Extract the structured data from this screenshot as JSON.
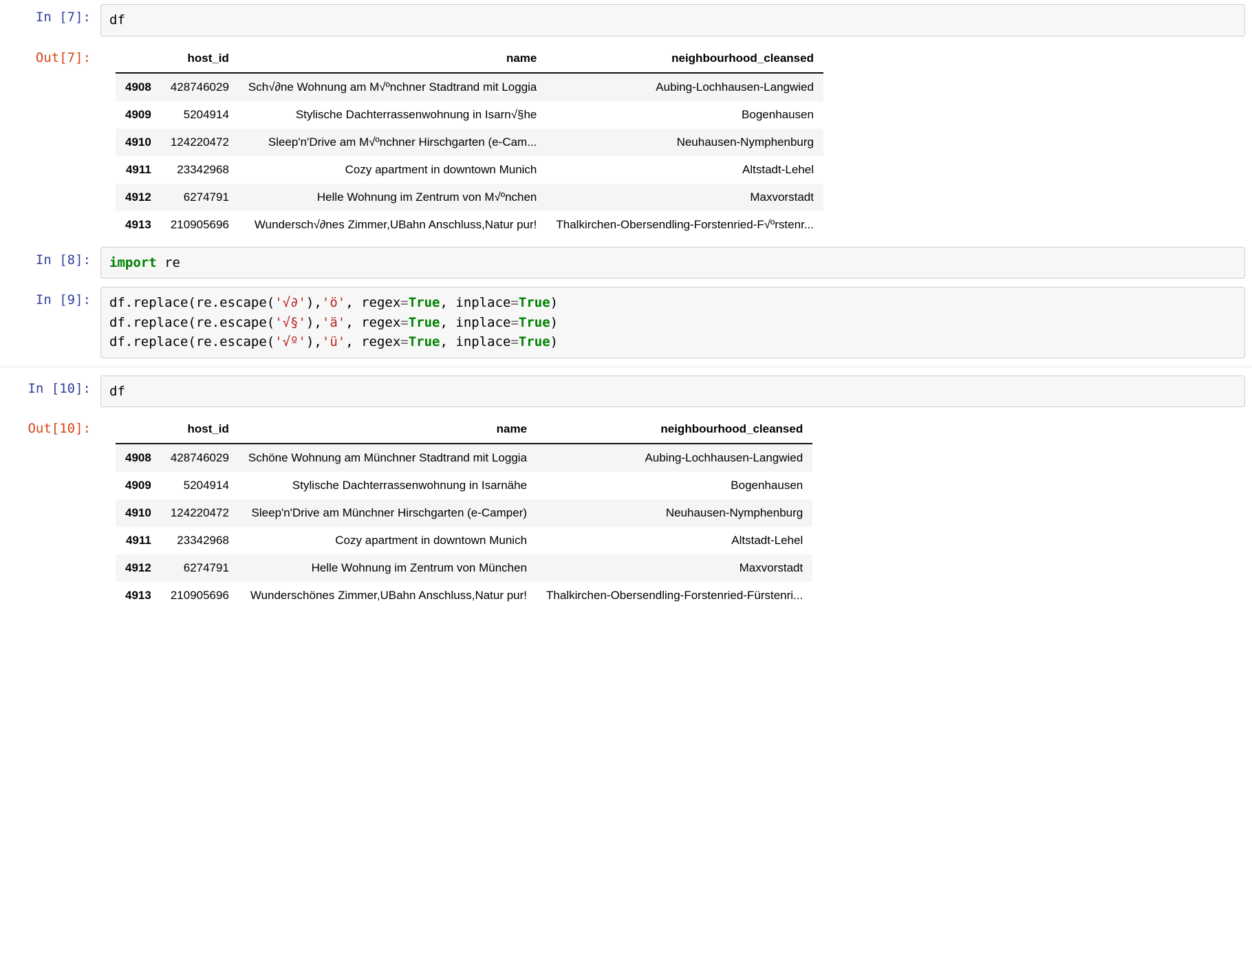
{
  "cells": [
    {
      "prompt_in": "In [7]:",
      "code_plain": "df",
      "prompt_out": "Out[7]:",
      "table": {
        "columns": [
          "",
          "host_id",
          "name",
          "neighbourhood_cleansed"
        ],
        "rows": [
          {
            "idx": "4908",
            "host_id": "428746029",
            "name": "Sch√∂ne Wohnung am M√ºnchner Stadtrand mit Loggia",
            "neighbourhood": "Aubing-Lochhausen-Langwied"
          },
          {
            "idx": "4909",
            "host_id": "5204914",
            "name": "Stylische Dachterrassenwohnung in Isarn√§he",
            "neighbourhood": "Bogenhausen"
          },
          {
            "idx": "4910",
            "host_id": "124220472",
            "name": "Sleep'n'Drive am M√ºnchner Hirschgarten (e-Cam...",
            "neighbourhood": "Neuhausen-Nymphenburg"
          },
          {
            "idx": "4911",
            "host_id": "23342968",
            "name": "Cozy apartment in downtown Munich",
            "neighbourhood": "Altstadt-Lehel"
          },
          {
            "idx": "4912",
            "host_id": "6274791",
            "name": "Helle Wohnung im Zentrum von M√ºnchen",
            "neighbourhood": "Maxvorstadt"
          },
          {
            "idx": "4913",
            "host_id": "210905696",
            "name": "Wundersch√∂nes Zimmer,UBahn Anschluss,Natur pur!",
            "neighbourhood": "Thalkirchen-Obersendling-Forstenried-F√ºrstenr..."
          }
        ]
      }
    },
    {
      "prompt_in": "In [8]:",
      "code_tokens": [
        [
          {
            "t": "import ",
            "c": "kw"
          },
          {
            "t": "re",
            "c": ""
          }
        ]
      ]
    },
    {
      "prompt_in": "In [9]:",
      "code_tokens": [
        [
          {
            "t": "df.replace(re.escape(",
            "c": ""
          },
          {
            "t": "'√∂'",
            "c": "str"
          },
          {
            "t": "),",
            "c": ""
          },
          {
            "t": "'ö'",
            "c": "str"
          },
          {
            "t": ", regex",
            "c": ""
          },
          {
            "t": "=",
            "c": "op"
          },
          {
            "t": "True",
            "c": "bool"
          },
          {
            "t": ", inplace",
            "c": ""
          },
          {
            "t": "=",
            "c": "op"
          },
          {
            "t": "True",
            "c": "bool"
          },
          {
            "t": ")",
            "c": ""
          }
        ],
        [
          {
            "t": "df.replace(re.escape(",
            "c": ""
          },
          {
            "t": "'√§'",
            "c": "str"
          },
          {
            "t": "),",
            "c": ""
          },
          {
            "t": "'ä'",
            "c": "str"
          },
          {
            "t": ", regex",
            "c": ""
          },
          {
            "t": "=",
            "c": "op"
          },
          {
            "t": "True",
            "c": "bool"
          },
          {
            "t": ", inplace",
            "c": ""
          },
          {
            "t": "=",
            "c": "op"
          },
          {
            "t": "True",
            "c": "bool"
          },
          {
            "t": ")",
            "c": ""
          }
        ],
        [
          {
            "t": "df.replace(re.escape(",
            "c": ""
          },
          {
            "t": "'√º'",
            "c": "str"
          },
          {
            "t": "),",
            "c": ""
          },
          {
            "t": "'ü'",
            "c": "str"
          },
          {
            "t": ", regex",
            "c": ""
          },
          {
            "t": "=",
            "c": "op"
          },
          {
            "t": "True",
            "c": "bool"
          },
          {
            "t": ", inplace",
            "c": ""
          },
          {
            "t": "=",
            "c": "op"
          },
          {
            "t": "True",
            "c": "bool"
          },
          {
            "t": ")",
            "c": ""
          }
        ]
      ]
    },
    {
      "prompt_in": "In [10]:",
      "code_plain": "df",
      "prompt_out": "Out[10]:",
      "table": {
        "columns": [
          "",
          "host_id",
          "name",
          "neighbourhood_cleansed"
        ],
        "rows": [
          {
            "idx": "4908",
            "host_id": "428746029",
            "name": "Schöne Wohnung am Münchner Stadtrand mit Loggia",
            "neighbourhood": "Aubing-Lochhausen-Langwied"
          },
          {
            "idx": "4909",
            "host_id": "5204914",
            "name": "Stylische Dachterrassenwohnung in Isarnähe",
            "neighbourhood": "Bogenhausen"
          },
          {
            "idx": "4910",
            "host_id": "124220472",
            "name": "Sleep'n'Drive am Münchner Hirschgarten (e-Camper)",
            "neighbourhood": "Neuhausen-Nymphenburg"
          },
          {
            "idx": "4911",
            "host_id": "23342968",
            "name": "Cozy apartment in downtown Munich",
            "neighbourhood": "Altstadt-Lehel"
          },
          {
            "idx": "4912",
            "host_id": "6274791",
            "name": "Helle Wohnung im Zentrum von München",
            "neighbourhood": "Maxvorstadt"
          },
          {
            "idx": "4913",
            "host_id": "210905696",
            "name": "Wunderschönes Zimmer,UBahn Anschluss,Natur pur!",
            "neighbourhood": "Thalkirchen-Obersendling-Forstenried-Fürstenri..."
          }
        ]
      }
    }
  ]
}
